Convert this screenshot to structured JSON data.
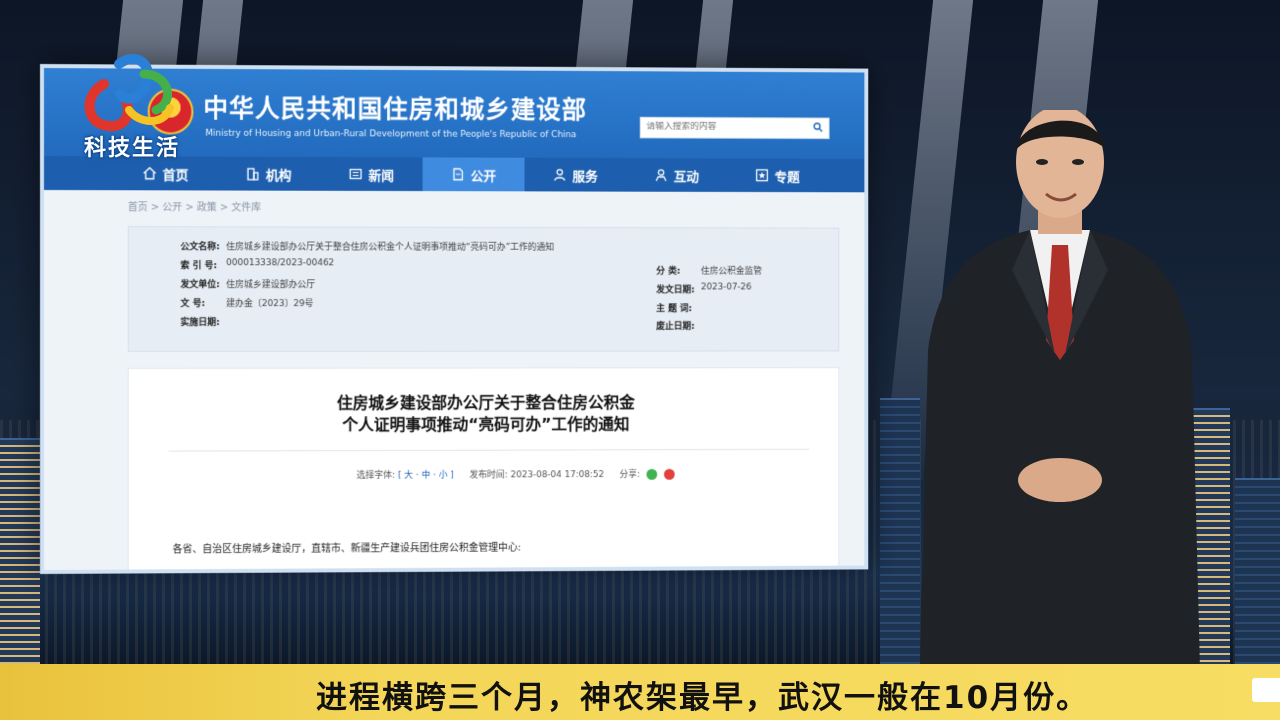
{
  "channel": {
    "name": "科技生活",
    "colors": {
      "logo_red": "#e0352b",
      "logo_blue": "#2a7fd6",
      "logo_green": "#45b04a",
      "logo_yellow": "#f5c324"
    }
  },
  "website": {
    "ministry_zh": "中华人民共和国住房和城乡建设部",
    "ministry_en": "Ministry of Housing and Urban-Rural Development of the People's Republic of China",
    "search": {
      "placeholder": "请输入搜索的内容",
      "icon": "search-icon"
    },
    "nav": [
      {
        "label": "首页",
        "icon": "home-icon"
      },
      {
        "label": "机构",
        "icon": "building-icon"
      },
      {
        "label": "新闻",
        "icon": "news-icon"
      },
      {
        "label": "公开",
        "icon": "document-icon",
        "active": true
      },
      {
        "label": "服务",
        "icon": "person-icon"
      },
      {
        "label": "互动",
        "icon": "chat-icon"
      },
      {
        "label": "专题",
        "icon": "star-icon"
      }
    ],
    "breadcrumb": [
      "首页",
      "公开",
      "政策",
      "文件库"
    ],
    "meta": {
      "doc_name_label": "公文名称:",
      "doc_name": "住房城乡建设部办公厅关于整合住房公积金个人证明事项推动“亮码可办”工作的通知",
      "index_label": "索 引 号:",
      "index": "000013338/2023-00462",
      "issuer_label": "发文单位:",
      "issuer": "住房城乡建设部办公厅",
      "docno_label": "文      号:",
      "docno": "建办金〔2023〕29号",
      "effective_label": "实施日期:",
      "category_label": "分      类:",
      "category": "住房公积金监管",
      "issue_date_label": "发文日期:",
      "issue_date": "2023-07-26",
      "subject_label": "主 题 词:",
      "expiry_label": "废止日期:"
    },
    "article": {
      "title_line1": "住房城乡建设部办公厅关于整合住房公积金",
      "title_line2": "个人证明事项推动“亮码可办”工作的通知",
      "font_label": "选择字体:",
      "font_options": "[ 大 · 中 · 小 ]",
      "publish_label": "发布时间:",
      "publish_time": "2023-08-04 17:08:52",
      "share_label": "分享:",
      "salutation": "各省、自治区住房城乡建设厅，直辖市、新疆生产建设兵团住房公积金管理中心:"
    }
  },
  "subtitle": "进程横跨三个月，神农架最早，武汉一般在10月份。"
}
